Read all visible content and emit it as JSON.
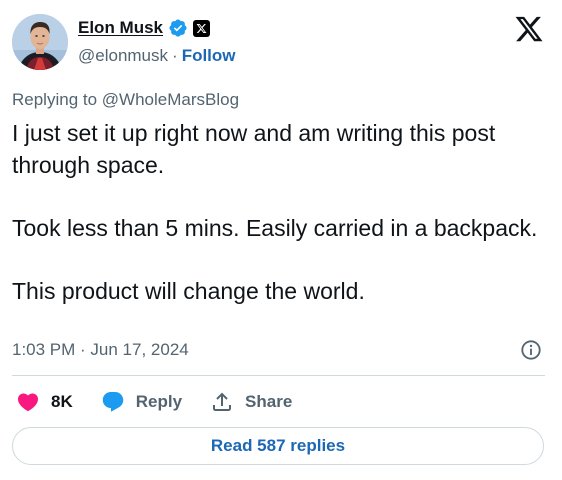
{
  "author": {
    "display_name": "Elon Musk",
    "handle": "@elonmusk",
    "separator": "·",
    "follow_label": "Follow",
    "avatar_icon": "avatar-photo",
    "verified_icon": "verified-badge-icon",
    "affiliation_icon": "x-affiliation-icon"
  },
  "brand_icon": "x-logo-icon",
  "tweet": {
    "replying_to": "Replying to @WholeMarsBlog",
    "paragraphs": [
      "I just set it up right now and am writing this post through space.",
      "Took less than 5 mins. Easily carried in a backpack.",
      "This product will change the world."
    ],
    "timestamp": "1:03 PM · Jun 17, 2024"
  },
  "actions": {
    "like_count": "8K",
    "reply_label": "Reply",
    "share_label": "Share"
  },
  "read_replies_label": "Read 587 replies",
  "colors": {
    "text": "#0f1419",
    "secondary": "#536471",
    "link": "#1d68b5",
    "like": "#f91880",
    "reply_bubble": "#1d9bf0",
    "verified": "#1d9bf0",
    "divider": "#cfd9de"
  }
}
